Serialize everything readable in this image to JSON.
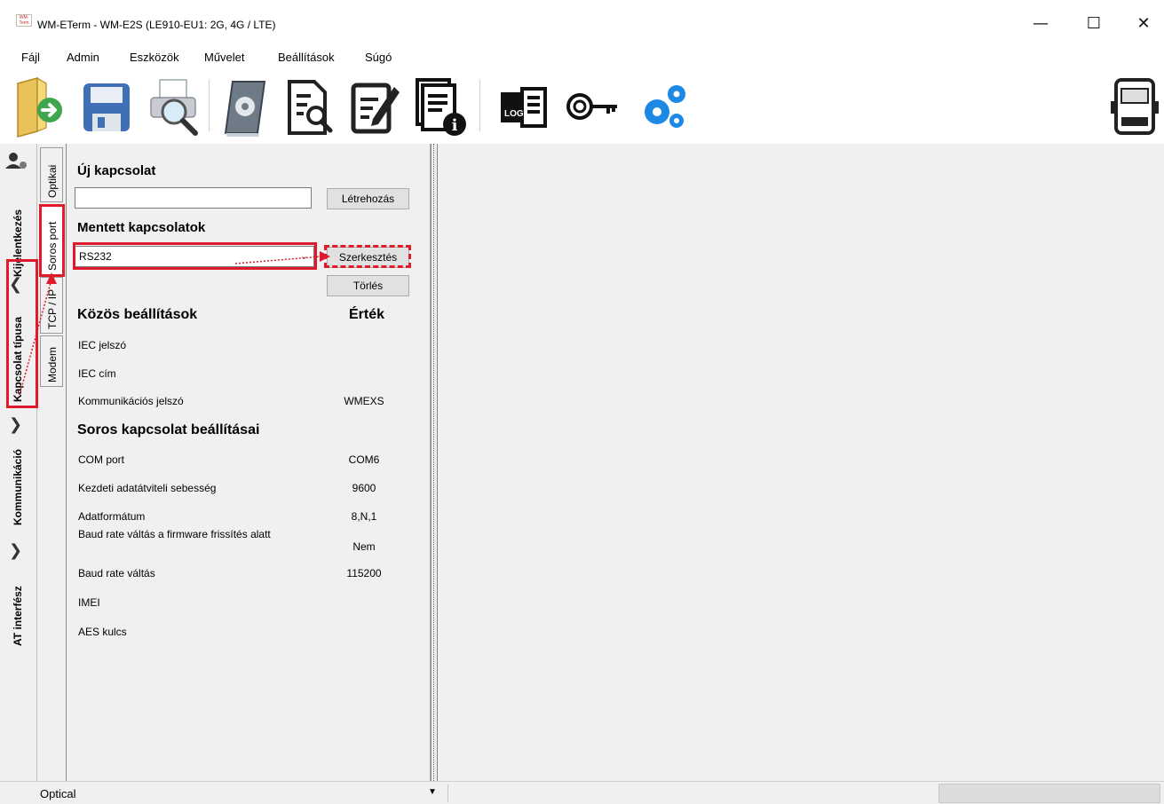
{
  "window": {
    "app_icon_text": "WM-Term",
    "title": "WM-ETerm - WM-E2S (LE910-EU1: 2G, 4G / LTE)",
    "minimize": "—",
    "maximize": "☐",
    "close": "✕"
  },
  "menu": [
    "Fájl",
    "Admin",
    "Eszközök",
    "Művelet",
    "Beállítások",
    "Súgó"
  ],
  "toolbar": {
    "buttons": [
      "open-folder-icon",
      "save-icon",
      "print-preview-icon",
      "parameters-book-icon",
      "read-document-icon",
      "edit-document-icon",
      "document-info-icon",
      "log-icon",
      "key-icon",
      "gears-icon",
      "meter-icon"
    ],
    "log_label": "LOG"
  },
  "side_tabs": {
    "login": "Kijelentkezés",
    "connection_type": "Kapcsolat típusa",
    "communication": "Kommunikáció",
    "at_interface": "AT interfész"
  },
  "conn_tabs": {
    "optical": "Optikai",
    "serial": "Soros port",
    "tcpip": "TCP / IP",
    "modem": "Modem"
  },
  "panel": {
    "new_conn_title": "Új kapcsolat",
    "new_conn_value": "",
    "create_button": "Létrehozás",
    "saved_title": "Mentett kapcsolatok",
    "saved_selected": "RS232",
    "edit_button": "Szerkesztés",
    "delete_button": "Törlés",
    "common_title": "Közös beállítások",
    "value_header": "Érték",
    "common_rows": [
      {
        "label": "IEC jelszó",
        "value": ""
      },
      {
        "label": "IEC cím",
        "value": ""
      },
      {
        "label": "Kommunikációs jelszó",
        "value": "WMEXS"
      }
    ],
    "serial_title": "Soros kapcsolat beállításai",
    "serial_rows": [
      {
        "label": "COM port",
        "value": "COM6"
      },
      {
        "label": "Kezdeti adatátviteli sebesség",
        "value": "9600"
      },
      {
        "label": "Adatformátum",
        "value": "8,N,1"
      },
      {
        "label": "Baud rate váltás a firmware frissítés alatt",
        "value": "Nem"
      },
      {
        "label": "Baud rate váltás",
        "value": "115200"
      },
      {
        "label": "IMEI",
        "value": ""
      },
      {
        "label": "AES kulcs",
        "value": ""
      }
    ]
  },
  "status": {
    "connection": "Optical",
    "dropdown_arrow": "▼"
  },
  "colors": {
    "highlight": "#e0192b",
    "panel_bg": "#f0f0f0",
    "gear_blue": "#1e88e5"
  }
}
